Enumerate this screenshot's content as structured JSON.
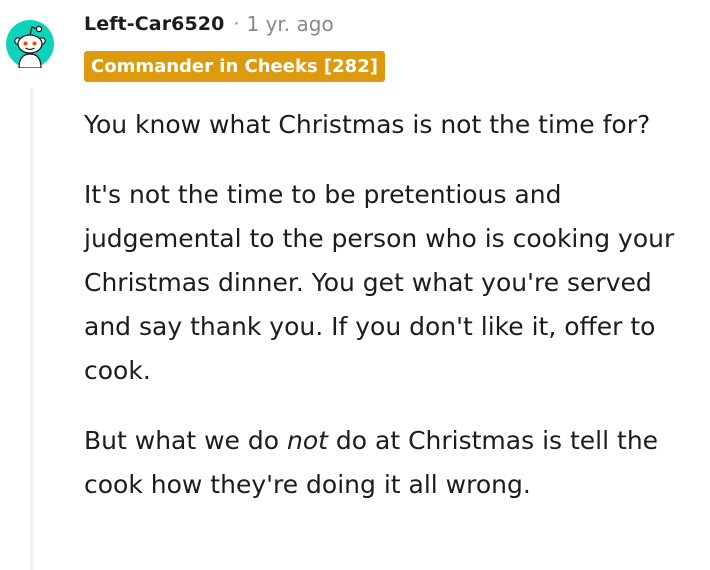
{
  "comment": {
    "author": "Left-Car6520",
    "separator": "·",
    "timestamp": "1 yr. ago",
    "flair": "Commander in Cheeks [282]",
    "avatar_icon": "snoo-avatar-icon",
    "paragraphs": [
      {
        "text": "You know what Christmas is not the time for?"
      },
      {
        "text": "It's not the time to be pretentious and judgemental to the person who is cooking your Christmas dinner. You get what you're served and say thank you. If you don't like it, offer to cook."
      },
      {
        "before": "But what we do ",
        "emphasis": "not",
        "after": " do at Christmas is tell the cook how they're doing it all wrong."
      }
    ]
  },
  "colors": {
    "flair_background": "#dd9a0d",
    "avatar_background": "#0dd3bb",
    "meta_text": "#878a8c",
    "thread_line": "#edeff1"
  }
}
